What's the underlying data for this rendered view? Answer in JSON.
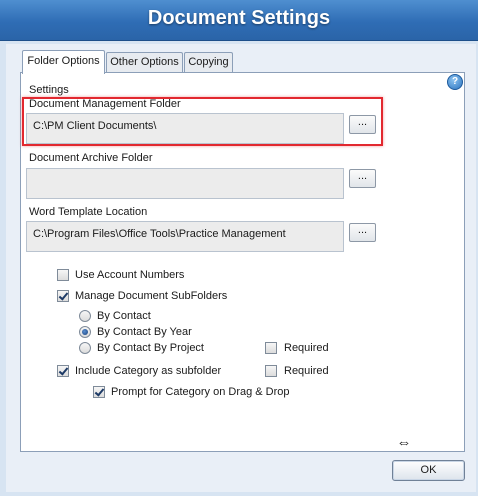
{
  "window": {
    "title": "Document Settings"
  },
  "tabs": [
    {
      "label": "Folder Options",
      "active": true
    },
    {
      "label": "Other Options",
      "active": false
    },
    {
      "label": "Copying",
      "active": false
    }
  ],
  "help_icon": "question-mark-icon",
  "settings": {
    "group_label": "Settings",
    "management_folder": {
      "label": "Document Management Folder",
      "value": "C:\\PM Client Documents\\",
      "browse_label": "..."
    },
    "archive_folder": {
      "label": "Document Archive Folder",
      "value": "",
      "browse_label": "..."
    },
    "word_template": {
      "label": "Word Template Location",
      "value": "C:\\Program Files\\Office Tools\\Practice Management",
      "browse_label": "..."
    }
  },
  "options": {
    "use_account_numbers": {
      "label": "Use Account Numbers",
      "checked": false
    },
    "manage_subfolders": {
      "label": "Manage Document SubFolders",
      "checked": true
    },
    "radios": [
      {
        "label": "By Contact",
        "selected": false
      },
      {
        "label": "By Contact By Year",
        "selected": true
      },
      {
        "label": "By Contact By Project",
        "selected": false
      }
    ],
    "project_required": {
      "label": "Required",
      "checked": false
    },
    "include_category": {
      "label": "Include Category as subfolder",
      "checked": true
    },
    "category_required": {
      "label": "Required",
      "checked": false
    },
    "prompt_category": {
      "label": "Prompt for Category on Drag & Drop",
      "checked": true
    }
  },
  "footer": {
    "ok_label": "OK",
    "resize_glyph": "⇔"
  },
  "colors": {
    "title_bar": "#2f6db5",
    "highlight": "#e2282f"
  }
}
